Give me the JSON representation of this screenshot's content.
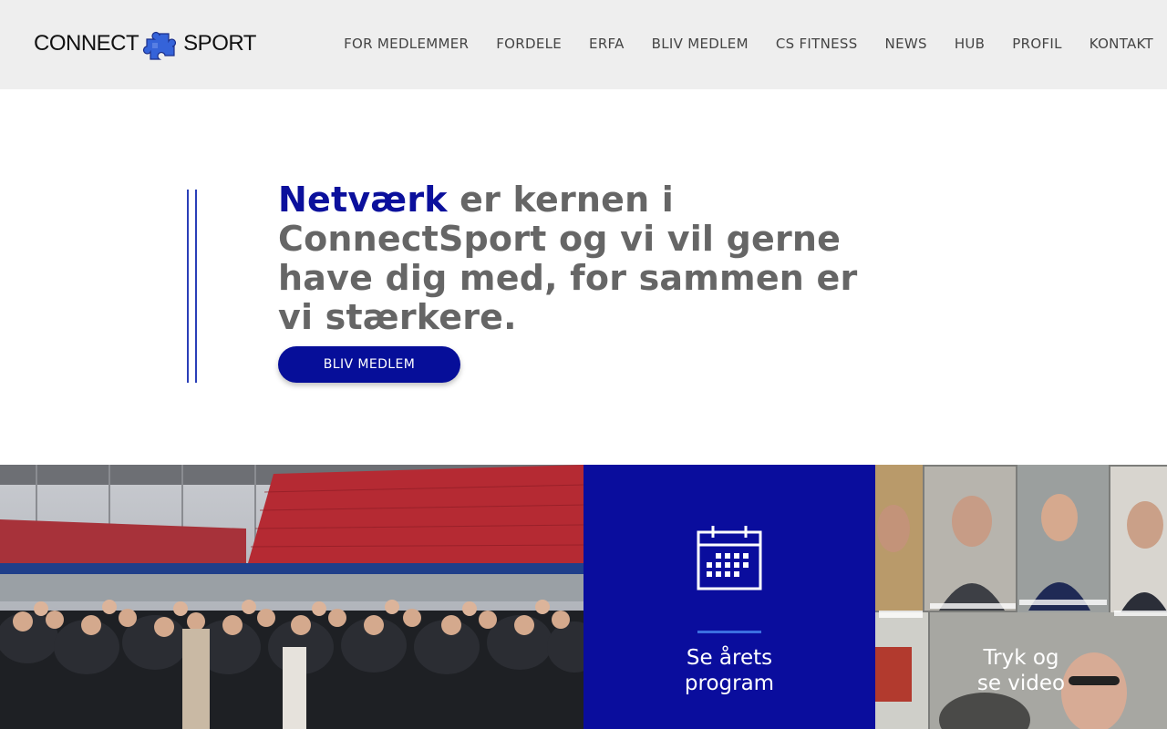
{
  "header": {
    "logo_left": "CONNECT",
    "logo_right": "SPORT",
    "nav": [
      {
        "label": "FOR MEDLEMMER"
      },
      {
        "label": "FORDELE"
      },
      {
        "label": "ERFA"
      },
      {
        "label": "BLIV MEDLEM"
      },
      {
        "label": "CS FITNESS"
      },
      {
        "label": "NEWS"
      },
      {
        "label": "HUB"
      },
      {
        "label": "PROFIL"
      },
      {
        "label": "KONTAKT"
      }
    ]
  },
  "hero": {
    "headline_accent": "Netværk",
    "headline_rest": " er kernen i ConnectSport og vi vil gerne have dig med, for sammen er vi stærkere.",
    "cta_label": "BLIV MEDLEM"
  },
  "tiles": {
    "program": {
      "label": "Se årets\nprogram",
      "icon": "calendar-icon"
    },
    "video": {
      "label": "Tryk og\nse video"
    }
  },
  "colors": {
    "brand_blue": "#0b109c",
    "button_blue": "#060e99",
    "tile_blue": "#0a0d9d",
    "accent_line": "#3b6fe0",
    "header_bg": "#eeeeee"
  }
}
